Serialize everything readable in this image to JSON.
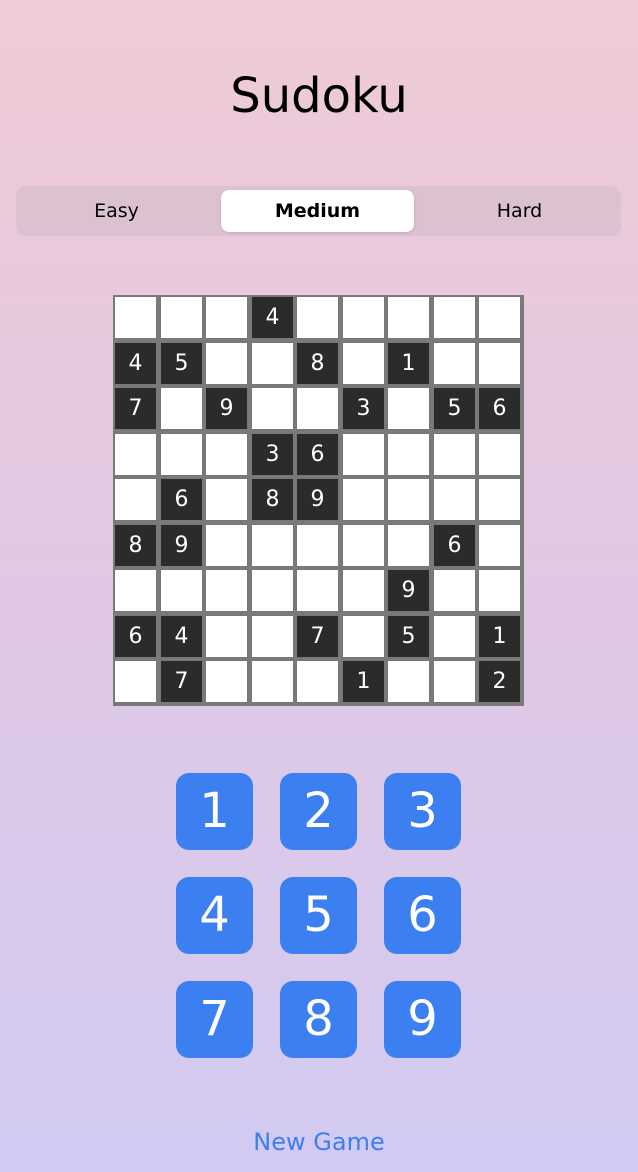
{
  "title": "Sudoku",
  "difficulty": {
    "options": [
      "Easy",
      "Medium",
      "Hard"
    ],
    "selected": "Medium"
  },
  "board": [
    [
      "",
      "",
      "",
      "4",
      "",
      "",
      "",
      "",
      ""
    ],
    [
      "4",
      "5",
      "",
      "",
      "8",
      "",
      "1",
      "",
      ""
    ],
    [
      "7",
      "",
      "9",
      "",
      "",
      "3",
      "",
      "5",
      "6"
    ],
    [
      "",
      "",
      "",
      "3",
      "6",
      "",
      "",
      "",
      ""
    ],
    [
      "",
      "6",
      "",
      "8",
      "9",
      "",
      "",
      "",
      ""
    ],
    [
      "8",
      "9",
      "",
      "",
      "",
      "",
      "",
      "6",
      ""
    ],
    [
      "",
      "",
      "",
      "",
      "",
      "",
      "9",
      "",
      ""
    ],
    [
      "6",
      "4",
      "",
      "",
      "7",
      "",
      "5",
      "",
      "1"
    ],
    [
      "",
      "7",
      "",
      "",
      "",
      "1",
      "",
      "",
      "2"
    ]
  ],
  "keypad": [
    "1",
    "2",
    "3",
    "4",
    "5",
    "6",
    "7",
    "8",
    "9"
  ],
  "new_game_label": "New Game",
  "colors": {
    "accent": "#3b7ff0",
    "given_cell": "#2b2b2b",
    "empty_cell": "#ffffff",
    "background_top": "#efcbd6",
    "background_bottom": "#d2caf2"
  }
}
